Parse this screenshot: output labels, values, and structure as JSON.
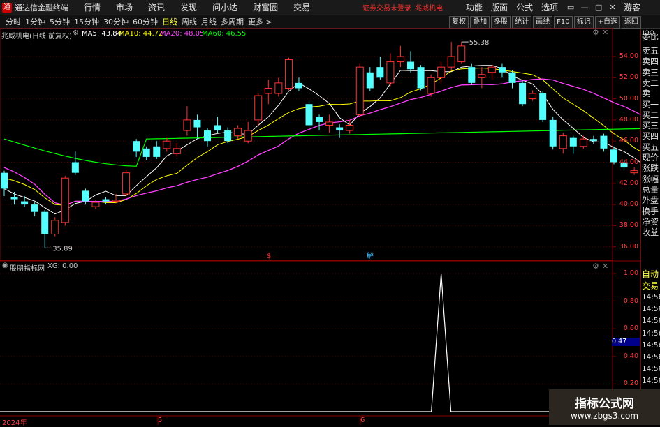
{
  "menubar": {
    "app_title": "通达信金融终端",
    "menus": [
      "行情",
      "市场",
      "资讯",
      "发现",
      "问小达",
      "财富圈",
      "交易"
    ],
    "alert": "证券交易未登录",
    "stock": "兆威机电",
    "right_menus": [
      "功能",
      "版面",
      "公式",
      "选项"
    ],
    "user": "游客"
  },
  "periodbar": {
    "tabs": [
      "分时",
      "1分钟",
      "5分钟",
      "15分钟",
      "30分钟",
      "60分钟",
      "日线",
      "周线",
      "月线",
      "多周期",
      "更多 >"
    ],
    "active": "日线",
    "right_buttons": [
      "复权",
      "叠加",
      "多股",
      "统计",
      "画线",
      "F10",
      "标记",
      "+自选",
      "返回"
    ]
  },
  "main_chart": {
    "title": "兆威机电(日线 前复权)",
    "ma": [
      {
        "label": "MA5: 43.84",
        "color": "#ffffff"
      },
      {
        "label": "MA10: 44.72",
        "color": "#ffff00"
      },
      {
        "label": "MA20: 48.05",
        "color": "#ff40ff"
      },
      {
        "label": "MA60: 46.55",
        "color": "#00ff00"
      }
    ],
    "y_ticks": [
      "54.00",
      "52.00",
      "50.00",
      "48.00",
      "46.00",
      "44.00",
      "42.00",
      "40.00",
      "38.00",
      "36.00"
    ],
    "high_label": "55.38",
    "low_label": "35.89",
    "markers": [
      "$",
      "解"
    ]
  },
  "indicator": {
    "title": "股朋指标网",
    "value": "XG: 0.00",
    "y_ticks": [
      "1.00",
      "0.80",
      "0.60",
      "0.40",
      "0.20"
    ],
    "current": "0.47"
  },
  "x_axis": [
    "2024年",
    "5",
    "6"
  ],
  "sidepanel": {
    "top": "委比",
    "items": [
      "卖五",
      "卖四",
      "卖三",
      "卖二",
      "卖一",
      "买一",
      "买二",
      "买三",
      "买四",
      "买五",
      "现价",
      "涨跌",
      "涨幅",
      "总量",
      "外盘",
      "换手",
      "净资",
      "收益",
      "自动",
      "交易"
    ],
    "times": [
      "14:56",
      "14:56",
      "14:56",
      "14:56",
      "14:56",
      "14:56",
      "14:56",
      "14:56"
    ]
  },
  "watermark": {
    "line1": "指标公式网",
    "line2": "www.zbgs3.com"
  },
  "chart_data": {
    "type": "candlestick",
    "candles": [
      [
        43.0,
        41.5,
        43.2,
        40.8
      ],
      [
        40.7,
        40.5,
        41.2,
        40.0
      ],
      [
        40.3,
        40.0,
        40.8,
        39.8
      ],
      [
        40.0,
        39.3,
        40.2,
        38.9
      ],
      [
        39.3,
        37.2,
        39.5,
        35.89
      ],
      [
        37.2,
        38.5,
        38.8,
        37.0
      ],
      [
        38.3,
        42.5,
        42.7,
        38.0
      ],
      [
        44.0,
        43.0,
        45.0,
        42.8
      ],
      [
        41.3,
        40.3,
        41.5,
        40.0
      ],
      [
        39.8,
        40.2,
        40.4,
        39.6
      ],
      [
        40.5,
        40.3,
        40.7,
        40.0
      ],
      [
        40.3,
        40.4,
        41.0,
        40.1
      ],
      [
        41.0,
        43.0,
        43.3,
        40.8
      ],
      [
        46.0,
        45.0,
        46.2,
        44.5
      ],
      [
        45.3,
        44.5,
        45.5,
        44.2
      ],
      [
        45.5,
        44.5,
        46.0,
        44.3
      ],
      [
        45.3,
        46.0,
        46.3,
        45.0
      ],
      [
        44.8,
        45.3,
        45.8,
        44.5
      ],
      [
        47.0,
        48.0,
        49.3,
        46.5
      ],
      [
        48.0,
        47.3,
        48.5,
        46.2
      ],
      [
        47.0,
        46.0,
        47.2,
        45.5
      ],
      [
        47.5,
        47.0,
        48.3,
        46.8
      ],
      [
        47.0,
        46.0,
        47.3,
        45.8
      ],
      [
        46.5,
        47.2,
        47.5,
        46.2
      ],
      [
        46.0,
        47.0,
        47.8,
        45.8
      ],
      [
        48.0,
        50.3,
        50.5,
        47.5
      ],
      [
        50.5,
        51.0,
        51.8,
        49.5
      ],
      [
        50.5,
        51.5,
        52.0,
        50.2
      ],
      [
        51.0,
        53.7,
        53.9,
        50.8
      ],
      [
        51.5,
        51.0,
        52.0,
        50.7
      ],
      [
        49.5,
        47.5,
        49.8,
        47.3
      ],
      [
        48.3,
        47.8,
        48.5,
        47.0
      ],
      [
        47.5,
        47.8,
        48.5,
        46.8
      ],
      [
        47.3,
        47.0,
        47.6,
        46.3
      ],
      [
        47.0,
        47.5,
        48.0,
        46.7
      ],
      [
        48.5,
        53.0,
        53.3,
        48.3
      ],
      [
        52.5,
        51.0,
        53.0,
        50.7
      ],
      [
        53.0,
        52.0,
        54.0,
        51.8
      ],
      [
        51.5,
        53.5,
        54.3,
        51.2
      ],
      [
        53.5,
        54.0,
        55.0,
        53.0
      ],
      [
        53.5,
        52.8,
        54.5,
        52.5
      ],
      [
        53.0,
        51.0,
        53.2,
        50.8
      ],
      [
        50.5,
        52.0,
        52.3,
        50.2
      ],
      [
        52.0,
        53.0,
        53.5,
        51.5
      ],
      [
        53.0,
        54.0,
        55.38,
        52.7
      ],
      [
        53.5,
        55.0,
        55.38,
        53.3
      ],
      [
        53.0,
        51.5,
        53.3,
        51.3
      ],
      [
        52.0,
        52.3,
        53.0,
        51.0
      ],
      [
        52.5,
        53.0,
        53.2,
        51.8
      ],
      [
        53.0,
        52.5,
        53.3,
        52.0
      ],
      [
        52.5,
        51.5,
        52.7,
        51.0
      ],
      [
        51.5,
        49.5,
        51.7,
        49.3
      ],
      [
        50.0,
        50.5,
        50.8,
        49.8
      ],
      [
        50.5,
        48.0,
        50.7,
        47.8
      ],
      [
        48.0,
        45.5,
        48.3,
        45.2
      ],
      [
        45.3,
        46.5,
        46.8,
        44.8
      ],
      [
        46.3,
        45.5,
        46.5,
        44.8
      ],
      [
        45.5,
        46.2,
        46.5,
        45.3
      ],
      [
        46.2,
        46.0,
        46.5,
        45.7
      ],
      [
        46.5,
        45.3,
        46.7,
        45.0
      ],
      [
        45.2,
        44.0,
        45.5,
        43.8
      ],
      [
        44.0,
        43.5,
        44.3,
        43.3
      ],
      [
        43.0,
        43.2,
        43.5,
        42.8
      ],
      [
        43.3,
        42.5,
        43.5,
        42.3
      ]
    ],
    "xg_signal_index": 43
  }
}
